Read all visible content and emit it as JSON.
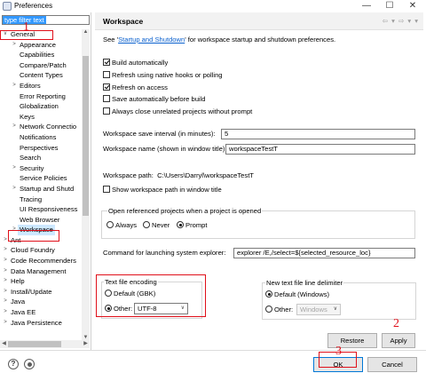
{
  "window": {
    "title": "Preferences",
    "icon": "preferences-app-icon",
    "controls": [
      "—",
      "☐",
      "✕"
    ]
  },
  "tree": {
    "filter_placeholder": "type filter text",
    "items": [
      {
        "label": "General",
        "expanded": true,
        "indent": 0
      },
      {
        "label": "Appearance",
        "indent": 1,
        "has_children": true
      },
      {
        "label": "Capabilities",
        "indent": 1
      },
      {
        "label": "Compare/Patch",
        "indent": 1
      },
      {
        "label": "Content Types",
        "indent": 1
      },
      {
        "label": "Editors",
        "indent": 1,
        "has_children": true
      },
      {
        "label": "Error Reporting",
        "indent": 1
      },
      {
        "label": "Globalization",
        "indent": 1
      },
      {
        "label": "Keys",
        "indent": 1
      },
      {
        "label": "Network Connectio",
        "indent": 1,
        "has_children": true
      },
      {
        "label": "Notifications",
        "indent": 1
      },
      {
        "label": "Perspectives",
        "indent": 1
      },
      {
        "label": "Search",
        "indent": 1
      },
      {
        "label": "Security",
        "indent": 1,
        "has_children": true
      },
      {
        "label": "Service Policies",
        "indent": 1
      },
      {
        "label": "Startup and Shutd",
        "indent": 1,
        "has_children": true
      },
      {
        "label": "Tracing",
        "indent": 1
      },
      {
        "label": "UI Responsiveness",
        "indent": 1
      },
      {
        "label": "Web Browser",
        "indent": 1
      },
      {
        "label": "Workspace",
        "indent": 1,
        "has_children": true,
        "selected": true
      },
      {
        "label": "Ant",
        "indent": 0,
        "has_children": true
      },
      {
        "label": "Cloud Foundry",
        "indent": 0,
        "has_children": true
      },
      {
        "label": "Code Recommenders",
        "indent": 0,
        "has_children": true
      },
      {
        "label": "Data Management",
        "indent": 0,
        "has_children": true
      },
      {
        "label": "Help",
        "indent": 0,
        "has_children": true
      },
      {
        "label": "Install/Update",
        "indent": 0,
        "has_children": true
      },
      {
        "label": "Java",
        "indent": 0,
        "has_children": true
      },
      {
        "label": "Java EE",
        "indent": 0,
        "has_children": true
      },
      {
        "label": "Java Persistence",
        "indent": 0,
        "has_children": true
      }
    ]
  },
  "panel": {
    "title": "Workspace",
    "nav_arrows": "⇦ ▾ ⇨ ▾ ▾",
    "intro_prefix": "See '",
    "intro_link": "Startup and Shutdown",
    "intro_suffix": "' for workspace startup and shutdown preferences.",
    "checkboxes": [
      {
        "label": "Build automatically",
        "checked": true
      },
      {
        "label": "Refresh using native hooks or polling",
        "checked": false
      },
      {
        "label": "Refresh on access",
        "checked": true
      },
      {
        "label": "Save automatically before build",
        "checked": false
      },
      {
        "label": "Always close unrelated projects without prompt",
        "checked": false
      }
    ],
    "save_interval_label": "Workspace save interval (in minutes):",
    "save_interval_value": "5",
    "workspace_name_label": "Workspace name (shown in window title):",
    "workspace_name_value": "workspaceTestT",
    "workspace_path_label": "Workspace path:",
    "workspace_path_value": "C:\\Users\\Darryl\\workspaceTestT",
    "show_path_label": "Show workspace path in window title",
    "open_referenced": {
      "legend": "Open referenced projects when a project is opened",
      "options": [
        "Always",
        "Never",
        "Prompt"
      ],
      "selected": "Prompt"
    },
    "explorer_label": "Command for launching system explorer:",
    "explorer_value": "explorer /E,/select=${selected_resource_loc}",
    "encoding": {
      "legend": "Text file encoding",
      "default_label": "Default (GBK)",
      "other_label": "Other:",
      "other_value": "UTF-8",
      "selected": "Other"
    },
    "line_delimiter": {
      "legend": "New text file line delimiter",
      "default_label": "Default (Windows)",
      "other_label": "Other:",
      "other_value": "Windows",
      "selected": "Default"
    },
    "restore_defaults_label": "Restore Defaults",
    "apply_label": "Apply"
  },
  "footer": {
    "ok_label": "OK",
    "cancel_label": "Cancel"
  },
  "annotations": {
    "one": "1",
    "two": "2",
    "three": "3"
  },
  "colors": {
    "annotation_red": "#e0101a",
    "selection_blue": "#3399ff",
    "link_blue": "#0b61ce",
    "tree_selected_bg": "#cde8ff"
  }
}
